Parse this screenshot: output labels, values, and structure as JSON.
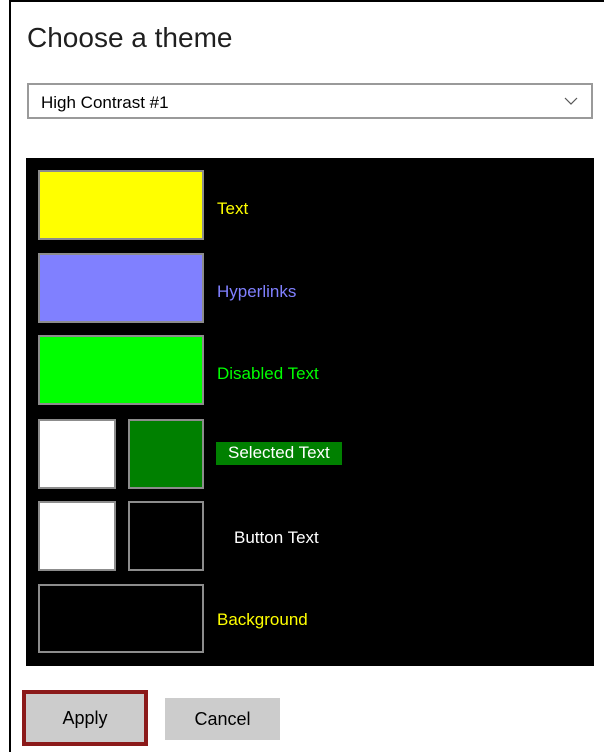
{
  "dialog": {
    "title": "Choose a theme"
  },
  "theme_select": {
    "selected": "High Contrast #1",
    "icon": "chevron-down-icon"
  },
  "preview": {
    "background_color": "#000000",
    "rows": [
      {
        "label": "Text",
        "label_color": "#ffff00",
        "swatch_colors": [
          "#ffff00"
        ]
      },
      {
        "label": "Hyperlinks",
        "label_color": "#8080ff",
        "swatch_colors": [
          "#8080ff"
        ]
      },
      {
        "label": "Disabled Text",
        "label_color": "#00ff00",
        "swatch_colors": [
          "#00ff00"
        ]
      },
      {
        "label": "Selected Text",
        "label_color": "#ffffff",
        "label_background": "#008000",
        "swatch_colors": [
          "#ffffff",
          "#008000"
        ]
      },
      {
        "label": "Button Text",
        "label_color": "#ffffff",
        "swatch_colors": [
          "#ffffff",
          "#000000"
        ]
      },
      {
        "label": "Background",
        "label_color": "#ffff00",
        "swatch_colors": [
          "#000000"
        ]
      }
    ]
  },
  "buttons": {
    "apply": "Apply",
    "cancel": "Cancel",
    "apply_highlight_color": "#8b1a1a"
  }
}
